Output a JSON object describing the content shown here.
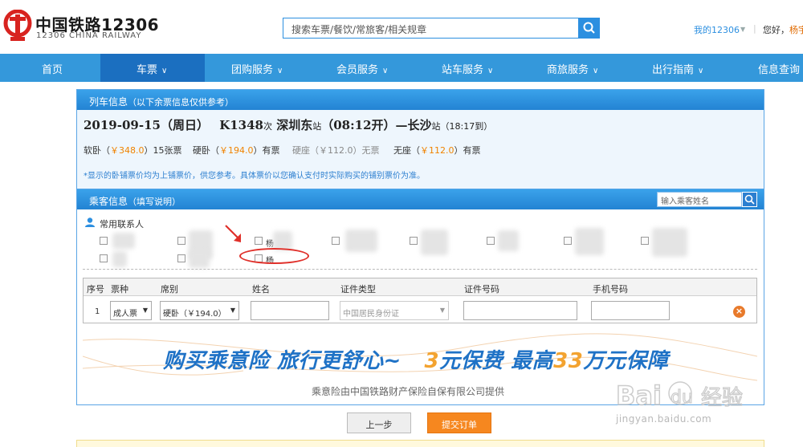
{
  "header": {
    "brand_cn": "中国铁路12306",
    "brand_en": "12306 CHINA RAILWAY",
    "search_placeholder": "搜索车票/餐饮/常旅客/相关规章",
    "my_account": "我的12306",
    "greeting": "您好，",
    "user_name": "杨宇"
  },
  "nav": {
    "items": [
      {
        "label": "首页"
      },
      {
        "label": "车票"
      },
      {
        "label": "团购服务"
      },
      {
        "label": "会员服务"
      },
      {
        "label": "站车服务"
      },
      {
        "label": "商旅服务"
      },
      {
        "label": "出行指南"
      },
      {
        "label": "信息查询"
      }
    ]
  },
  "train_panel": {
    "title": "列车信息",
    "title_note": "（以下余票信息仅供参考）",
    "date": "2019-09-15（周日）",
    "train_no": "K1348",
    "train_suffix": "次",
    "from": "深圳东",
    "station_suffix": "站",
    "depart": "（08:12开）",
    "dash": "—",
    "to": "长沙",
    "arrive": "（18:17到）",
    "seats": [
      {
        "name": "软卧",
        "price": "￥348.0",
        "avail": "15张票"
      },
      {
        "name": "硬卧",
        "price": "￥194.0",
        "avail": "有票"
      },
      {
        "name": "硬座",
        "price": "￥112.0",
        "avail": "无票"
      },
      {
        "name": "无座",
        "price": "￥112.0",
        "avail": "有票"
      }
    ],
    "note": "*显示的卧铺票价均为上铺票价，供您参考。具体票价以您确认支付时实际购买的铺别票价为准。"
  },
  "passenger_panel": {
    "title": "乘客信息",
    "title_note": "（填写说明）",
    "search_placeholder": "输入乘客姓名",
    "contacts_label": "常用联系人",
    "contact_first_chars": [
      "",
      "",
      "杨",
      "",
      "",
      "",
      "",
      "",
      "",
      "",
      "杨"
    ]
  },
  "table": {
    "headers": [
      "序号",
      "票种",
      "席别",
      "姓名",
      "证件类型",
      "证件号码",
      "手机号码"
    ],
    "row": {
      "index": "1",
      "ticket_type": "成人票",
      "seat_class": "硬卧（￥194.0）",
      "id_type": "中国居民身份证"
    }
  },
  "insurance": {
    "headline_a": "购买乘意险  旅行更舒心~",
    "headline_b1": "3",
    "headline_b2": "元保费  最高",
    "headline_b3": "33",
    "headline_b4": "万元保障",
    "provider": "乘意险由中国铁路财产保险自保有限公司提供"
  },
  "actions": {
    "prev": "上一步",
    "submit": "提交订单"
  },
  "watermark": {
    "url": "jingyan.baidu.com"
  },
  "colors": {
    "nav_bg": "#3498db",
    "accent_orange": "#f6871f",
    "link_blue": "#2c8fe0"
  }
}
